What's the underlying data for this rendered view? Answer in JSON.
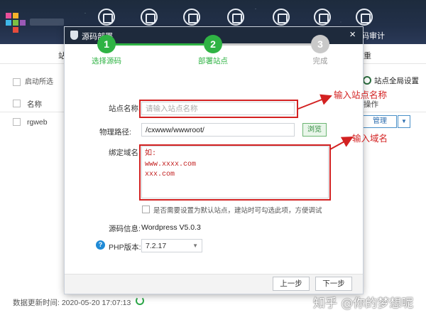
{
  "app": {
    "nav_items": [
      {
        "label": "",
        "icon": "rocket-icon"
      },
      {
        "label": "",
        "icon": "monitor-icon"
      },
      {
        "label": "",
        "icon": "server-icon"
      },
      {
        "label": "",
        "icon": "db-icon"
      },
      {
        "label": "",
        "icon": "shield-icon"
      },
      {
        "label": "",
        "icon": "gear-icon"
      },
      {
        "label": "码审计",
        "icon": "audit-icon"
      }
    ],
    "tab_left": "站",
    "tab_right": "重",
    "toolbar": {
      "start_label": "启动所选",
      "global_settings_label": "站点全局设置"
    },
    "table": {
      "col_name": "名称",
      "col_ops": "操作",
      "row_name": "rgweb",
      "manage_label": "管理"
    },
    "status": {
      "update_time": "数据更新时间: 2020-05-20 17:07:13"
    }
  },
  "dialog": {
    "title": "源码部署",
    "close": "×",
    "steps": [
      {
        "num": "1",
        "label": "选择源码",
        "state": "done"
      },
      {
        "num": "2",
        "label": "部署站点",
        "state": "active"
      },
      {
        "num": "3",
        "label": "完成",
        "state": "pending"
      }
    ],
    "site_name_label": "站点名称:",
    "site_name_placeholder": "请输入站点名称",
    "site_name_value": "",
    "physical_path_label": "物理路径:",
    "physical_path_value": "/cxwww/wwwroot/",
    "browse_label": "浏览",
    "domain_label": "绑定域名:",
    "domain_lines": [
      "如:",
      "www.xxxx.com",
      "xxx.com"
    ],
    "default_site_text": "是否需要设置为默认站点，建站时可勾选此项，方便调试",
    "default_site_checked": false,
    "source_info_label": "源码信息:",
    "source_info_value": "Wordpress V5.0.3",
    "php_label": "PHP版本:",
    "php_value": "7.2.17",
    "prev_label": "上一步",
    "next_label": "下一步"
  },
  "annotations": {
    "site_name": "输入站点名称",
    "domain": "输入域名"
  },
  "watermark": "知乎 @你的梦想呢",
  "colors": {
    "step_done": "#2fb344",
    "step_pending": "#c9c9c9",
    "annotation": "#d32121",
    "titlebar": "#1e2a3c"
  }
}
